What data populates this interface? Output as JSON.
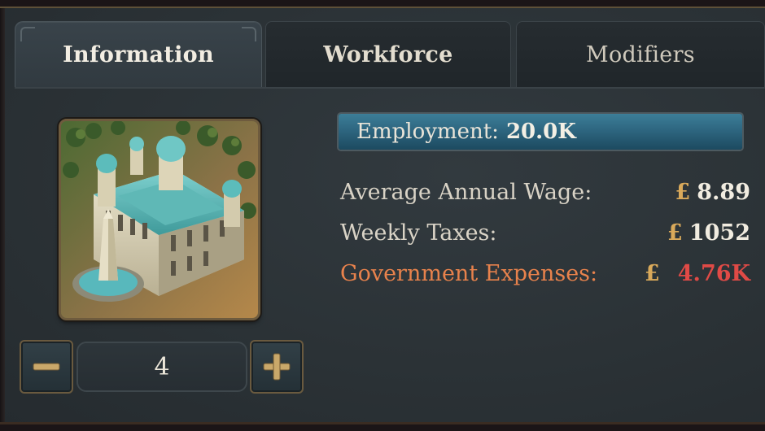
{
  "tabs": [
    {
      "label": "Information",
      "active": true
    },
    {
      "label": "Workforce",
      "active": false
    },
    {
      "label": "Modifiers",
      "active": false
    }
  ],
  "building": {
    "icon": "government-administration-building-icon"
  },
  "stepper": {
    "value": "4",
    "minus_icon": "minus-icon",
    "plus_icon": "plus-icon"
  },
  "employment": {
    "label": "Employment:",
    "value": "20.0K",
    "fill_fraction": 1.0
  },
  "stats": {
    "wage": {
      "label": "Average Annual Wage:",
      "currency": "£",
      "value": "8.89"
    },
    "taxes": {
      "label": "Weekly Taxes:",
      "currency": "£",
      "value": "1052"
    },
    "expenses": {
      "label": "Government Expenses:",
      "currency": "£",
      "value": "4.76K"
    }
  },
  "colors": {
    "accent_gold": "#d9a95a",
    "expense_label": "#e8824c",
    "expense_value": "#e04a46",
    "employment_fill": "#2e6680"
  }
}
